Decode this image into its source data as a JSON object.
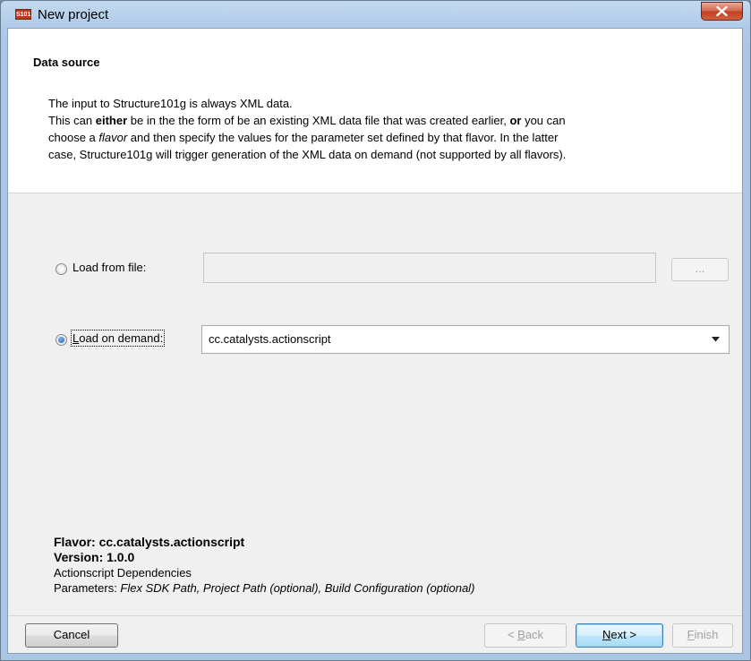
{
  "window": {
    "title": "New project",
    "icon_text": "S101"
  },
  "header": {
    "title": "Data source",
    "line1": "The input to Structure101g is always XML data.",
    "line2_prefix": "This can ",
    "line2_bold1": "either",
    "line2_middle": " be in the the form of be an existing XML data file that was created earlier, ",
    "line2_bold2": "or",
    "line2_suffix": " you can",
    "line3_prefix": "choose a ",
    "line3_italic": "flavor",
    "line3_suffix": " and then specify the values for the parameter set defined by that flavor. In the latter",
    "line4": "case, Structure101g will trigger generation of the XML data on demand (not supported by all flavors)."
  },
  "source": {
    "load_from_file_label": "Load from file:",
    "file_path_value": "",
    "browse_label": "...",
    "load_on_demand_label_first": "L",
    "load_on_demand_label_rest": "oad on demand:",
    "selected_flavor": "cc.catalysts.actionscript",
    "load_from_file_selected": false,
    "load_on_demand_selected": true
  },
  "flavor_info": {
    "flavor_line": "Flavor: cc.catalysts.actionscript",
    "version_line": "Version: 1.0.0",
    "description": "Actionscript Dependencies",
    "parameters_prefix": "Parameters: ",
    "parameters_list": "Flex SDK Path, Project Path (optional), Build Configuration (optional)"
  },
  "footer": {
    "cancel_label": "Cancel",
    "back_prefix": "< ",
    "back_mnemonic": "B",
    "back_rest": "ack",
    "next_mnemonic": "N",
    "next_rest": "ext >",
    "finish_mnemonic": "F",
    "finish_rest": "inish"
  },
  "colors": {
    "accent_blue": "#3c7fb1",
    "close_red": "#c33f22",
    "panel_bg": "#f0f0f0"
  }
}
